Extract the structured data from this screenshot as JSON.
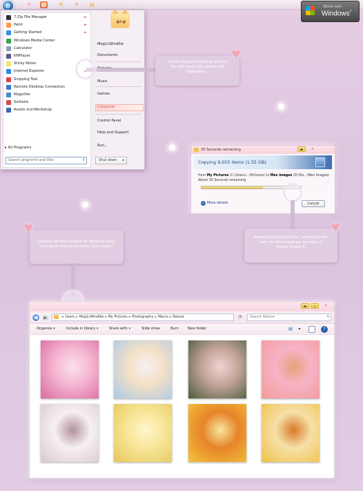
{
  "taskbar": {
    "icons": [
      {
        "name": "star-icon",
        "glyph": "★",
        "color": "#f2a6b8"
      },
      {
        "name": "photo-app-icon",
        "glyph": "✿",
        "color": "#ffffff",
        "active": true
      },
      {
        "name": "flower-icon",
        "glyph": "❀",
        "color": "#e9b96a"
      },
      {
        "name": "pencil-icon",
        "glyph": "✎",
        "color": "#e59a6a"
      },
      {
        "name": "document-icon",
        "glyph": "▤",
        "color": "#e8b46a"
      }
    ]
  },
  "badge": {
    "line1": "Works with",
    "line2": "Windows",
    "version": "7"
  },
  "start_menu": {
    "programs": [
      {
        "label": "7-Zip File Manager",
        "icon_color": "#2f2f2f",
        "has_arrow": true
      },
      {
        "label": "Paint",
        "icon_color": "#ff9a3c",
        "has_arrow": true
      },
      {
        "label": "Getting Started",
        "icon_color": "#3b8fe0",
        "has_arrow": true
      },
      {
        "label": "Windows Media Center",
        "icon_color": "#3aa34a",
        "has_arrow": false
      },
      {
        "label": "Calculator",
        "icon_color": "#8aa0b8",
        "has_arrow": false
      },
      {
        "label": "KMPlayer",
        "icon_color": "#5a5a8a",
        "has_arrow": false
      },
      {
        "label": "Sticky Notes",
        "icon_color": "#f4e36a",
        "has_arrow": false
      },
      {
        "label": "Internet Explorer",
        "icon_color": "#2a8ae0",
        "has_arrow": true
      },
      {
        "label": "Snipping Tool",
        "icon_color": "#e04050",
        "has_arrow": false
      },
      {
        "label": "Remote Desktop Connection",
        "icon_color": "#3a7ad0",
        "has_arrow": false
      },
      {
        "label": "Magnifier",
        "icon_color": "#4a8ad0",
        "has_arrow": false
      },
      {
        "label": "Solitaire",
        "icon_color": "#d04a4a",
        "has_arrow": false
      },
      {
        "label": "Axialis IconWorkshop",
        "icon_color": "#3a6ab0",
        "has_arrow": false
      }
    ],
    "all_programs": "All Programs",
    "search_placeholder": "Search programs and files",
    "right_links": [
      "Meg1cWind0w",
      "Documents",
      "Pictures",
      "Music",
      "Games",
      "Computer",
      "Control Panel",
      "Help and Support",
      "Run..."
    ],
    "shutdown": "Shut down"
  },
  "callouts": {
    "hearts": "Hearts shaped instead of arrows! For still more love, peace and happiness ...",
    "glowing": "Glowing window shadow for Windows Aero. Look great with pastel colors and papers!",
    "progress": "Redesigned progress bar, inspired by the user interface mockups concepts of Mozilla Firefox 4."
  },
  "copy_dialog": {
    "title": "30 Seconds remaining",
    "heading": "Copying 9,055 items (1.55 GB)",
    "from_prefix": "from",
    "from_bold": "My Pictures",
    "from_mid": "(C:\\Users\\...\\Pictures) to",
    "to_bold": "Mes images",
    "to_rest": "(D:\\Do...\\Mes images)",
    "eta": "About 30 Seconds remaining",
    "progress": 0.62,
    "more_details": "More details",
    "cancel": "Cancel"
  },
  "explorer": {
    "breadcrumbs": [
      "Users",
      "Meg1cWind0w",
      "My Pictures",
      "Photography",
      "Macro",
      "Nature"
    ],
    "search_placeholder": "Search Nature",
    "toolbar": [
      {
        "label": "Organize",
        "dropdown": true
      },
      {
        "label": "Include in library",
        "dropdown": true
      },
      {
        "label": "Share with",
        "dropdown": true
      },
      {
        "label": "Slide show",
        "dropdown": false
      },
      {
        "label": "Burn",
        "dropdown": false
      },
      {
        "label": "New folder",
        "dropdown": false
      }
    ],
    "thumbnails": [
      {
        "name": "photo-pink-flower",
        "colors": [
          "#d86aa0",
          "#f6b7d2",
          "#fbe0ee"
        ]
      },
      {
        "name": "photo-pale-blossom",
        "colors": [
          "#a9c9e6",
          "#f4e0c6",
          "#f8f0f6"
        ]
      },
      {
        "name": "photo-ladybug-leaves",
        "colors": [
          "#4a5a3a",
          "#c6a69a",
          "#f1d2d2"
        ]
      },
      {
        "name": "photo-pink-petal-drop",
        "colors": [
          "#f39a9a",
          "#f6b3c6",
          "#e8a27a"
        ]
      },
      {
        "name": "photo-dry-branches",
        "colors": [
          "#d8c8d0",
          "#f6f0f3",
          "#b2909a"
        ]
      },
      {
        "name": "photo-yellow-dewdrop",
        "colors": [
          "#e6c65a",
          "#f8e79a",
          "#fff5cc"
        ]
      },
      {
        "name": "photo-yellow-flower",
        "colors": [
          "#f3c53a",
          "#e6842a",
          "#f7e8a0"
        ]
      },
      {
        "name": "photo-orange-petals",
        "colors": [
          "#f0c04a",
          "#f6e0a8",
          "#d87a2a"
        ]
      }
    ]
  }
}
